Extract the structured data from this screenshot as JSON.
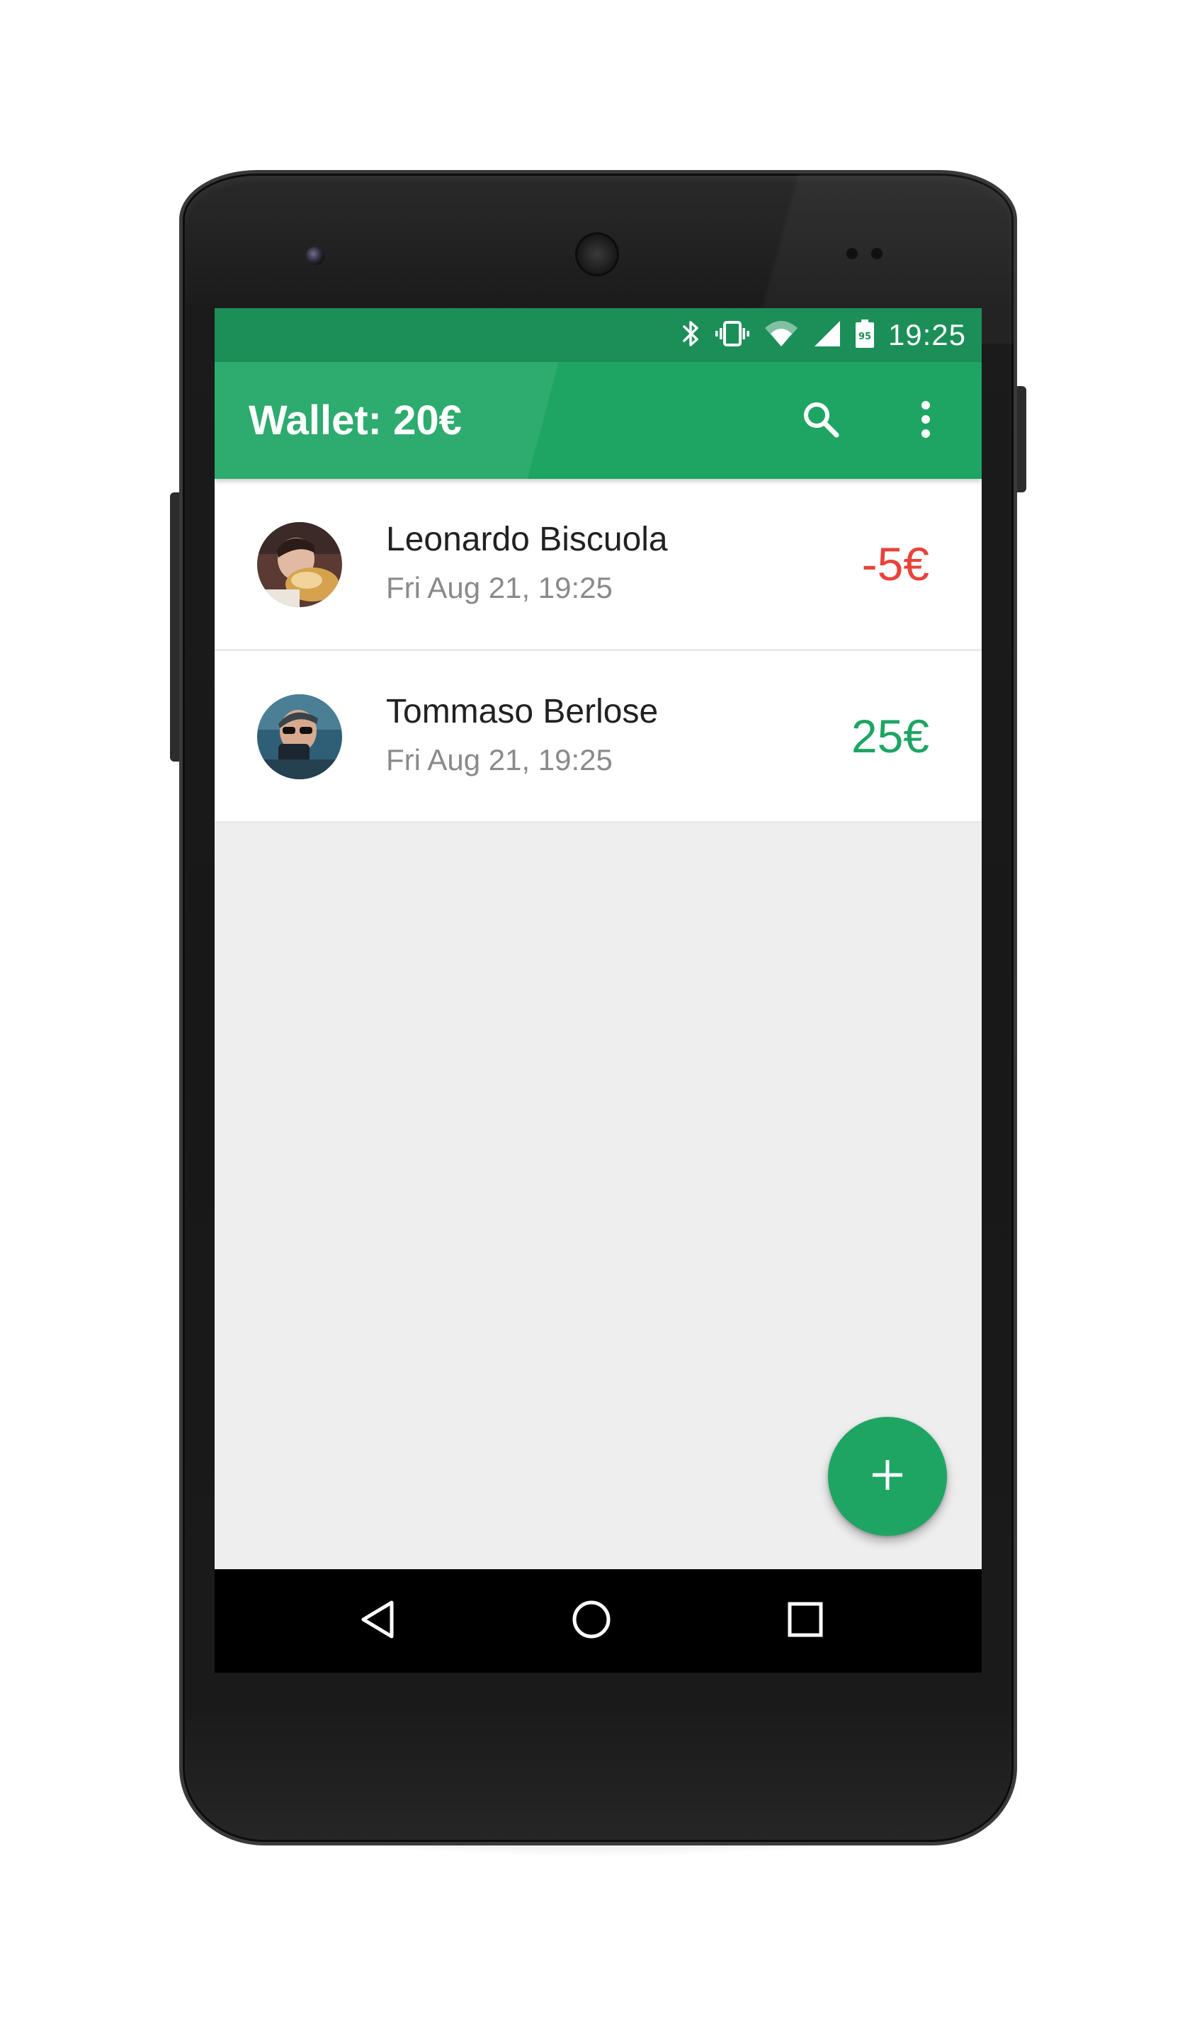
{
  "status_bar": {
    "time": "19:25",
    "battery_level": "95",
    "icons": [
      "bluetooth-icon",
      "vibrate-icon",
      "wifi-icon",
      "signal-icon",
      "battery-icon"
    ]
  },
  "app_bar": {
    "title": "Wallet: 20€",
    "actions": [
      "search-icon",
      "more-vert-icon"
    ]
  },
  "transactions": [
    {
      "name": "Leonardo Biscuola",
      "date": "Fri Aug 21, 19:25",
      "amount": "-5€",
      "type": "negative"
    },
    {
      "name": "Tommaso Berlose",
      "date": "Fri Aug 21, 19:25",
      "amount": "25€",
      "type": "positive"
    }
  ],
  "fab": {
    "icon": "add-icon"
  },
  "nav_bar": {
    "icons": [
      "back-icon",
      "home-icon",
      "recents-icon"
    ]
  },
  "colors": {
    "primary": "#1ea563",
    "primary_dark": "#1c8f58",
    "negative": "#e8433b",
    "positive": "#1ea563",
    "background": "#eeeeee"
  }
}
